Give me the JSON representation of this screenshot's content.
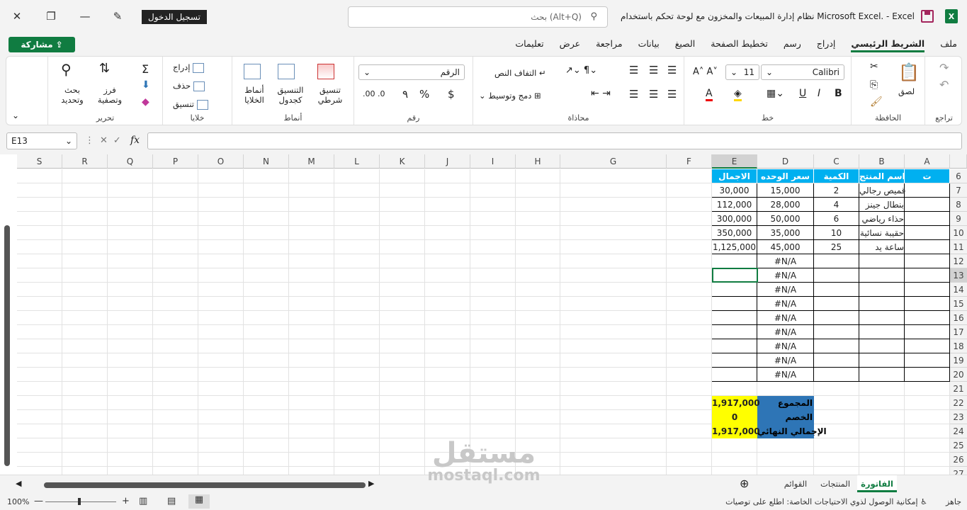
{
  "titlebar": {
    "signin": "تسجيل الدخول",
    "search_placeholder": "بحث (Alt+Q)",
    "document_title": "نظام إدارة المبيعات والمخزون مع لوحة تحكم باستخدام Microsoft Excel.  -  Excel",
    "app_logo": "X"
  },
  "menubar": {
    "share": "مشاركة",
    "tabs": [
      "ملف",
      "الشريط الرئيسي",
      "إدراج",
      "رسم",
      "تخطيط الصفحة",
      "الصيغ",
      "بيانات",
      "مراجعة",
      "عرض",
      "تعليمات"
    ],
    "active": "الشريط الرئيسي"
  },
  "ribbon": {
    "undo_group": "تراجع",
    "clipboard": {
      "label": "الحافظة",
      "paste": "لصق"
    },
    "font": {
      "label": "خط",
      "name": "Calibri",
      "size": "11",
      "bold": "B",
      "italic": "I",
      "underline": "U"
    },
    "alignment": {
      "label": "محاذاة",
      "wrap": "التفاف النص",
      "merge": "دمج وتوسيط"
    },
    "number": {
      "label": "رقم",
      "format": "الرقم",
      "currency": "$",
      "percent": "%",
      "comma": "٩"
    },
    "styles": {
      "label": "أنماط",
      "conditional": "تنسيق شرطي",
      "as_table": "التنسيق كجدول",
      "cell_styles": "أنماط الخلايا"
    },
    "cells": {
      "label": "خلايا",
      "insert": "إدراج",
      "delete": "حذف",
      "format": "تنسيق"
    },
    "editing": {
      "label": "تحرير",
      "sort": "فرز وتصفية",
      "find": "بحث وتحديد"
    }
  },
  "formula_bar": {
    "name_box": "E13",
    "fx": "fx",
    "value": ""
  },
  "columns": [
    {
      "id": "A",
      "label": "A"
    },
    {
      "id": "B",
      "label": "B"
    },
    {
      "id": "C",
      "label": "C"
    },
    {
      "id": "D",
      "label": "D"
    },
    {
      "id": "E",
      "label": "E"
    },
    {
      "id": "F",
      "label": "F"
    },
    {
      "id": "G",
      "label": "G"
    },
    {
      "id": "H",
      "label": "H"
    },
    {
      "id": "I",
      "label": "I"
    },
    {
      "id": "J",
      "label": "J"
    },
    {
      "id": "K",
      "label": "K"
    },
    {
      "id": "L",
      "label": "L"
    },
    {
      "id": "M",
      "label": "M"
    },
    {
      "id": "N",
      "label": "N"
    },
    {
      "id": "O",
      "label": "O"
    },
    {
      "id": "P",
      "label": "P"
    },
    {
      "id": "Q",
      "label": "Q"
    },
    {
      "id": "R",
      "label": "R"
    },
    {
      "id": "S",
      "label": "S"
    }
  ],
  "rows": [
    "6",
    "7",
    "8",
    "9",
    "10",
    "11",
    "12",
    "13",
    "14",
    "15",
    "16",
    "17",
    "18",
    "19",
    "20",
    "21",
    "22",
    "23",
    "24",
    "25",
    "26",
    "27"
  ],
  "table": {
    "headers": [
      "ت",
      "اسم المنتج",
      "الكمية",
      "سعر الوحده",
      "الاجمال"
    ],
    "items": [
      [
        "",
        "قميص رجالي",
        "2",
        "15,000",
        "30,000"
      ],
      [
        "",
        "بنطال جينز",
        "4",
        "28,000",
        "112,000"
      ],
      [
        "",
        "حذاء رياضي",
        "6",
        "50,000",
        "300,000"
      ],
      [
        "",
        "حقيبة نسائية",
        "10",
        "35,000",
        "350,000"
      ],
      [
        "",
        "ساعة يد",
        "25",
        "45,000",
        "1,125,000"
      ]
    ],
    "na_value": "#N/A"
  },
  "totals": {
    "sum_label": "المجموع",
    "sum_value": "1,917,000",
    "discount_label": "الخصم",
    "discount_value": "0",
    "final_label": "الإجمالي النهائي",
    "final_value": "1,917,000"
  },
  "sheets": [
    "الفاتورة",
    "المنتجات",
    "القوائم"
  ],
  "active_sheet": "الفاتورة",
  "status": {
    "ready": "جاهز",
    "accessibility": "إمكانية الوصول لذوي الاحتياجات الخاصة: اطلع على توصيات",
    "zoom": "100%"
  },
  "watermark": {
    "arabic": "مستقل",
    "latin": "mostaql.com"
  },
  "colors": {
    "accent": "#107c41",
    "table_header": "#00b0f0",
    "totals_label": "#2e75b6",
    "totals_value": "#ffff00"
  }
}
